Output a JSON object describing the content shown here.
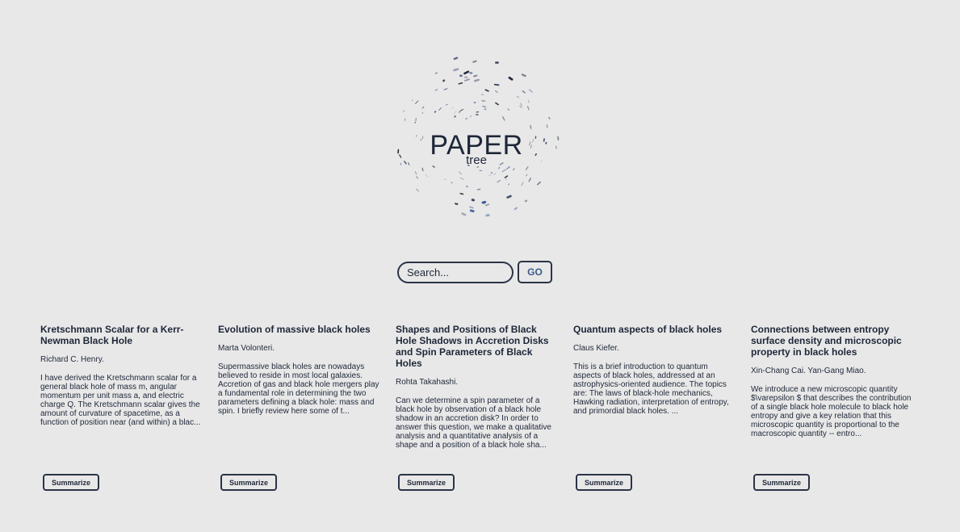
{
  "logo": {
    "title": "PAPER",
    "subtitle": "tree"
  },
  "search": {
    "placeholder": "Search...",
    "value": "",
    "go_label": "GO"
  },
  "papers": [
    {
      "title": "Kretschmann Scalar for a Kerr-Newman Black Hole",
      "authors": "Richard C. Henry.",
      "abstract": "I have derived the Kretschmann scalar for a general black hole of mass m, angular momentum per unit mass a, and electric charge Q. The Kretschmann scalar gives the amount of curvature of spacetime, as a function of position near (and within) a blac...",
      "button_label": "Summarize"
    },
    {
      "title": "Evolution of massive black holes",
      "authors": "Marta Volonteri.",
      "abstract": "Supermassive black holes are nowadays believed to reside in most local galaxies. Accretion of gas and black hole mergers play a fundamental role in determining the two parameters defining a black hole: mass and spin. I briefly review here some of t...",
      "button_label": "Summarize"
    },
    {
      "title": "Shapes and Positions of Black Hole Shadows in Accretion Disks and Spin Parameters of Black Holes",
      "authors": "Rohta Takahashi.",
      "abstract": "Can we determine a spin parameter of a black hole by observation of a black hole shadow in an accretion disk? In order to answer this question, we make a qualitative analysis and a quantitative analysis of a shape and a position of a black hole sha...",
      "button_label": "Summarize"
    },
    {
      "title": "Quantum aspects of black holes",
      "authors": "Claus Kiefer.",
      "abstract": "This is a brief introduction to quantum aspects of black holes, addressed at an astrophysics-oriented audience. The topics are: The laws of black-hole mechanics, Hawking radiation, interpretation of entropy, and primordial black holes. ...",
      "button_label": "Summarize"
    },
    {
      "title": "Connections between entropy surface density and microscopic property in black holes",
      "authors": "Xin-Chang Cai. Yan-Gang Miao.",
      "abstract": "We introduce a new microscopic quantity $\\varepsilon $ that describes the contribution of a single black hole molecule to black hole entropy and give a key relation that this microscopic quantity is proportional to the macroscopic quantity -- entro...",
      "button_label": "Summarize"
    }
  ],
  "colors": {
    "background": "#e8e8e8",
    "ink": "#1e2738",
    "accent": "#3b5a8a"
  }
}
